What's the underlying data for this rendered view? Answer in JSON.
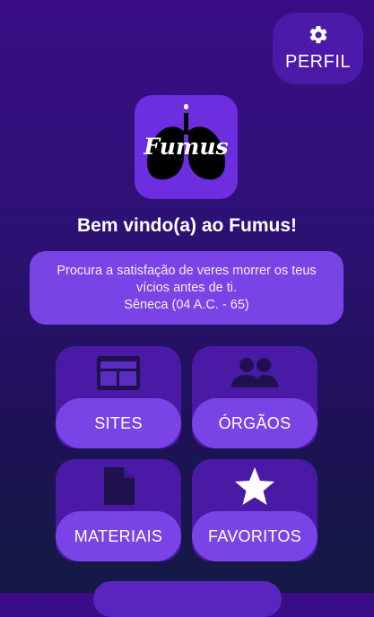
{
  "profile": {
    "label": "PERFIL",
    "icon": "gear-icon"
  },
  "logo": {
    "text": "Fumus",
    "icon": "lungs-icon"
  },
  "welcome": {
    "title": "Bem vindo(a) ao Fumus!"
  },
  "quote": {
    "text": "Procura a satisfação de veres morrer os teus vícios antes de ti.",
    "author": "Sêneca (04 A.C. - 65)"
  },
  "menu": {
    "sites": {
      "label": "SITES",
      "icon": "web-layout-icon"
    },
    "orgaos": {
      "label": "ÓRGÃOS",
      "icon": "people-icon"
    },
    "materiais": {
      "label": "MATERIAIS",
      "icon": "document-icon"
    },
    "favoritos": {
      "label": "FAVORITOS",
      "icon": "star-icon"
    }
  },
  "colors": {
    "background_top": "#3a0d86",
    "background_bottom": "#141a44",
    "tile": "#4a1aa6",
    "pill": "#7a43e6"
  }
}
